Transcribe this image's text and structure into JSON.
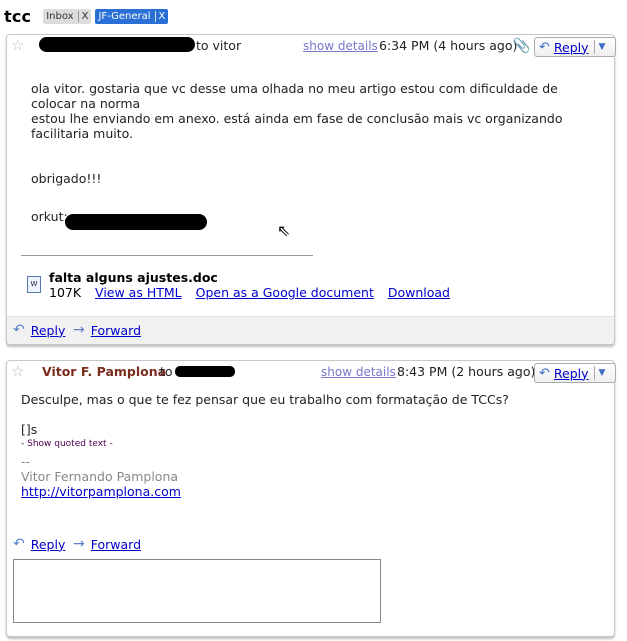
{
  "thread": {
    "subject": "tcc",
    "labels": [
      {
        "text": "Inbox",
        "remove": "X"
      },
      {
        "text": "JF-General",
        "remove": "X"
      }
    ]
  },
  "messages": [
    {
      "to_text": "to vitor",
      "show_details": "show details",
      "time": "6:34 PM (4 hours ago)",
      "reply_label": "Reply",
      "body_lines": [
        "ola vitor. gostaria que vc desse uma olhada no meu artigo estou com dificuldade de colocar na norma",
        "estou lhe enviando em anexo.  está ainda em fase de conclusão mais vc organizando facilitaria muito.",
        "obrigado!!!",
        "orkut:"
      ],
      "attachment": {
        "name": "falta alguns ajustes.doc",
        "size": "107K",
        "view_html": "View as HTML",
        "open_google": "Open as a Google document",
        "download": "Download"
      },
      "footer": {
        "reply": "Reply",
        "forward": "Forward"
      }
    },
    {
      "sender": "Vitor F. Pamplona",
      "to_text": "to",
      "show_details": "show details",
      "time": "8:43 PM (2 hours ago)",
      "reply_label": "Reply",
      "body_lines": [
        "Desculpe, mas o que te fez pensar que eu trabalho com formatação de TCCs?",
        "[]s"
      ],
      "quoted_toggle": "- Show quoted text -",
      "signature": {
        "dashes": "--",
        "name": "Vitor Fernando Pamplona",
        "link": "http://vitorpamplona.com"
      },
      "footer": {
        "reply": "Reply",
        "forward": "Forward"
      }
    }
  ],
  "icons": {
    "star": "star-icon",
    "paperclip": "paperclip-icon",
    "reply_arrow": "reply-arrow-icon",
    "forward_arrow": "forward-arrow-icon",
    "dropdown": "chevron-down-icon",
    "doc": "word-doc-icon"
  },
  "colors": {
    "sender": "#7b2d1e",
    "link": "#0000cc",
    "label_accent": "#2a6fd6",
    "quoted": "#500050"
  }
}
